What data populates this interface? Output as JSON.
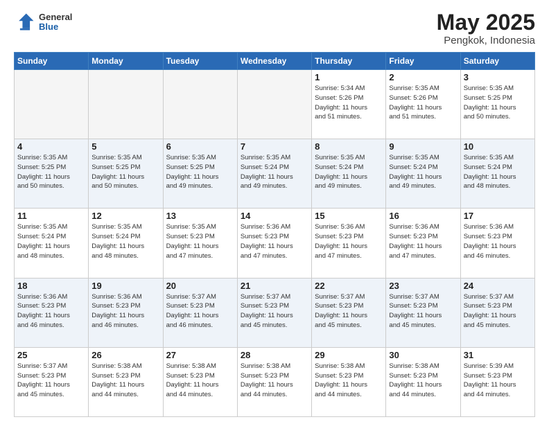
{
  "logo": {
    "general": "General",
    "blue": "Blue"
  },
  "header": {
    "month": "May 2025",
    "location": "Pengkok, Indonesia"
  },
  "weekdays": [
    "Sunday",
    "Monday",
    "Tuesday",
    "Wednesday",
    "Thursday",
    "Friday",
    "Saturday"
  ],
  "rows": [
    [
      {
        "day": "",
        "info": "",
        "empty": true
      },
      {
        "day": "",
        "info": "",
        "empty": true
      },
      {
        "day": "",
        "info": "",
        "empty": true
      },
      {
        "day": "",
        "info": "",
        "empty": true
      },
      {
        "day": "1",
        "info": "Sunrise: 5:34 AM\nSunset: 5:26 PM\nDaylight: 11 hours\nand 51 minutes."
      },
      {
        "day": "2",
        "info": "Sunrise: 5:35 AM\nSunset: 5:26 PM\nDaylight: 11 hours\nand 51 minutes."
      },
      {
        "day": "3",
        "info": "Sunrise: 5:35 AM\nSunset: 5:25 PM\nDaylight: 11 hours\nand 50 minutes."
      }
    ],
    [
      {
        "day": "4",
        "info": "Sunrise: 5:35 AM\nSunset: 5:25 PM\nDaylight: 11 hours\nand 50 minutes."
      },
      {
        "day": "5",
        "info": "Sunrise: 5:35 AM\nSunset: 5:25 PM\nDaylight: 11 hours\nand 50 minutes."
      },
      {
        "day": "6",
        "info": "Sunrise: 5:35 AM\nSunset: 5:25 PM\nDaylight: 11 hours\nand 49 minutes."
      },
      {
        "day": "7",
        "info": "Sunrise: 5:35 AM\nSunset: 5:24 PM\nDaylight: 11 hours\nand 49 minutes."
      },
      {
        "day": "8",
        "info": "Sunrise: 5:35 AM\nSunset: 5:24 PM\nDaylight: 11 hours\nand 49 minutes."
      },
      {
        "day": "9",
        "info": "Sunrise: 5:35 AM\nSunset: 5:24 PM\nDaylight: 11 hours\nand 49 minutes."
      },
      {
        "day": "10",
        "info": "Sunrise: 5:35 AM\nSunset: 5:24 PM\nDaylight: 11 hours\nand 48 minutes."
      }
    ],
    [
      {
        "day": "11",
        "info": "Sunrise: 5:35 AM\nSunset: 5:24 PM\nDaylight: 11 hours\nand 48 minutes."
      },
      {
        "day": "12",
        "info": "Sunrise: 5:35 AM\nSunset: 5:24 PM\nDaylight: 11 hours\nand 48 minutes."
      },
      {
        "day": "13",
        "info": "Sunrise: 5:35 AM\nSunset: 5:23 PM\nDaylight: 11 hours\nand 47 minutes."
      },
      {
        "day": "14",
        "info": "Sunrise: 5:36 AM\nSunset: 5:23 PM\nDaylight: 11 hours\nand 47 minutes."
      },
      {
        "day": "15",
        "info": "Sunrise: 5:36 AM\nSunset: 5:23 PM\nDaylight: 11 hours\nand 47 minutes."
      },
      {
        "day": "16",
        "info": "Sunrise: 5:36 AM\nSunset: 5:23 PM\nDaylight: 11 hours\nand 47 minutes."
      },
      {
        "day": "17",
        "info": "Sunrise: 5:36 AM\nSunset: 5:23 PM\nDaylight: 11 hours\nand 46 minutes."
      }
    ],
    [
      {
        "day": "18",
        "info": "Sunrise: 5:36 AM\nSunset: 5:23 PM\nDaylight: 11 hours\nand 46 minutes."
      },
      {
        "day": "19",
        "info": "Sunrise: 5:36 AM\nSunset: 5:23 PM\nDaylight: 11 hours\nand 46 minutes."
      },
      {
        "day": "20",
        "info": "Sunrise: 5:37 AM\nSunset: 5:23 PM\nDaylight: 11 hours\nand 46 minutes."
      },
      {
        "day": "21",
        "info": "Sunrise: 5:37 AM\nSunset: 5:23 PM\nDaylight: 11 hours\nand 45 minutes."
      },
      {
        "day": "22",
        "info": "Sunrise: 5:37 AM\nSunset: 5:23 PM\nDaylight: 11 hours\nand 45 minutes."
      },
      {
        "day": "23",
        "info": "Sunrise: 5:37 AM\nSunset: 5:23 PM\nDaylight: 11 hours\nand 45 minutes."
      },
      {
        "day": "24",
        "info": "Sunrise: 5:37 AM\nSunset: 5:23 PM\nDaylight: 11 hours\nand 45 minutes."
      }
    ],
    [
      {
        "day": "25",
        "info": "Sunrise: 5:37 AM\nSunset: 5:23 PM\nDaylight: 11 hours\nand 45 minutes."
      },
      {
        "day": "26",
        "info": "Sunrise: 5:38 AM\nSunset: 5:23 PM\nDaylight: 11 hours\nand 44 minutes."
      },
      {
        "day": "27",
        "info": "Sunrise: 5:38 AM\nSunset: 5:23 PM\nDaylight: 11 hours\nand 44 minutes."
      },
      {
        "day": "28",
        "info": "Sunrise: 5:38 AM\nSunset: 5:23 PM\nDaylight: 11 hours\nand 44 minutes."
      },
      {
        "day": "29",
        "info": "Sunrise: 5:38 AM\nSunset: 5:23 PM\nDaylight: 11 hours\nand 44 minutes."
      },
      {
        "day": "30",
        "info": "Sunrise: 5:38 AM\nSunset: 5:23 PM\nDaylight: 11 hours\nand 44 minutes."
      },
      {
        "day": "31",
        "info": "Sunrise: 5:39 AM\nSunset: 5:23 PM\nDaylight: 11 hours\nand 44 minutes."
      }
    ]
  ]
}
